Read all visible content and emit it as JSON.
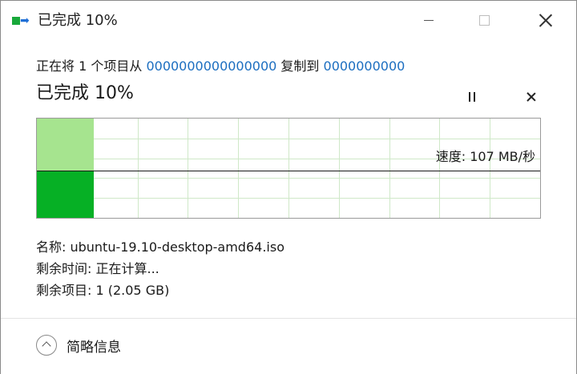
{
  "window": {
    "title": "已完成 10%",
    "icon": "file-copy-icon"
  },
  "copy": {
    "prefix": "正在将 1 个项目从 ",
    "source": "0000000000000000",
    "middle": " 复制到 ",
    "destination": "0000000000"
  },
  "progress": {
    "heading": "已完成 10%",
    "percent": 10
  },
  "graph": {
    "speed_label": "速度: 107 MB/秒"
  },
  "details": {
    "name": "名称: ubuntu-19.10-desktop-amd64.iso",
    "time_remaining": "剩余时间: 正在计算...",
    "items_remaining": "剩余项目: 1 (2.05 GB)"
  },
  "footer": {
    "toggle_label": "简略信息"
  },
  "colors": {
    "progress_light": "#a6e48f",
    "progress_dark": "#06b025",
    "link": "#1c6ec0"
  }
}
